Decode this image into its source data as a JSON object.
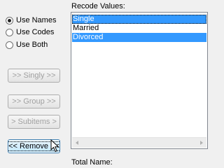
{
  "mode_options": [
    {
      "label": "Use Names",
      "checked": true
    },
    {
      "label": "Use Codes",
      "checked": false
    },
    {
      "label": "Use Both",
      "checked": false
    }
  ],
  "buttons": {
    "singly": ">> Singly >>",
    "group": ">> Group >>",
    "subitems": "> Subitems >",
    "remove": "<< Remove <<"
  },
  "recode": {
    "label": "Recode Values:",
    "items": [
      "Single",
      "Married",
      "Divorced"
    ],
    "selected": [
      "Single",
      "Divorced"
    ],
    "focused": "Single"
  },
  "total_name_label": "Total Name:",
  "colors": {
    "selection": "#3399ff"
  }
}
